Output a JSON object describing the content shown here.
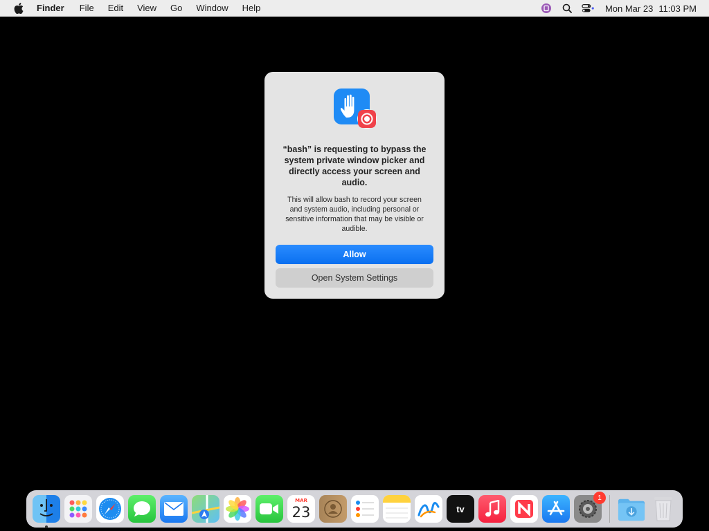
{
  "menubar": {
    "app_name": "Finder",
    "menus": [
      "File",
      "Edit",
      "View",
      "Go",
      "Window",
      "Help"
    ],
    "date": "Mon Mar 23",
    "time": "11:03 PM"
  },
  "dialog": {
    "title": "“bash” is requesting to bypass the system private window picker and directly access your screen and audio.",
    "body": "This will allow bash to record your screen and system audio, including personal or sensitive information that may be visible or audible.",
    "allow_label": "Allow",
    "settings_label": "Open System Settings"
  },
  "dock": {
    "calendar_month": "MAR",
    "calendar_day": "23",
    "tv_label": "tv",
    "settings_badge": "1"
  },
  "colors": {
    "accent": "#0a6ff0",
    "badge": "#ff3b30"
  }
}
